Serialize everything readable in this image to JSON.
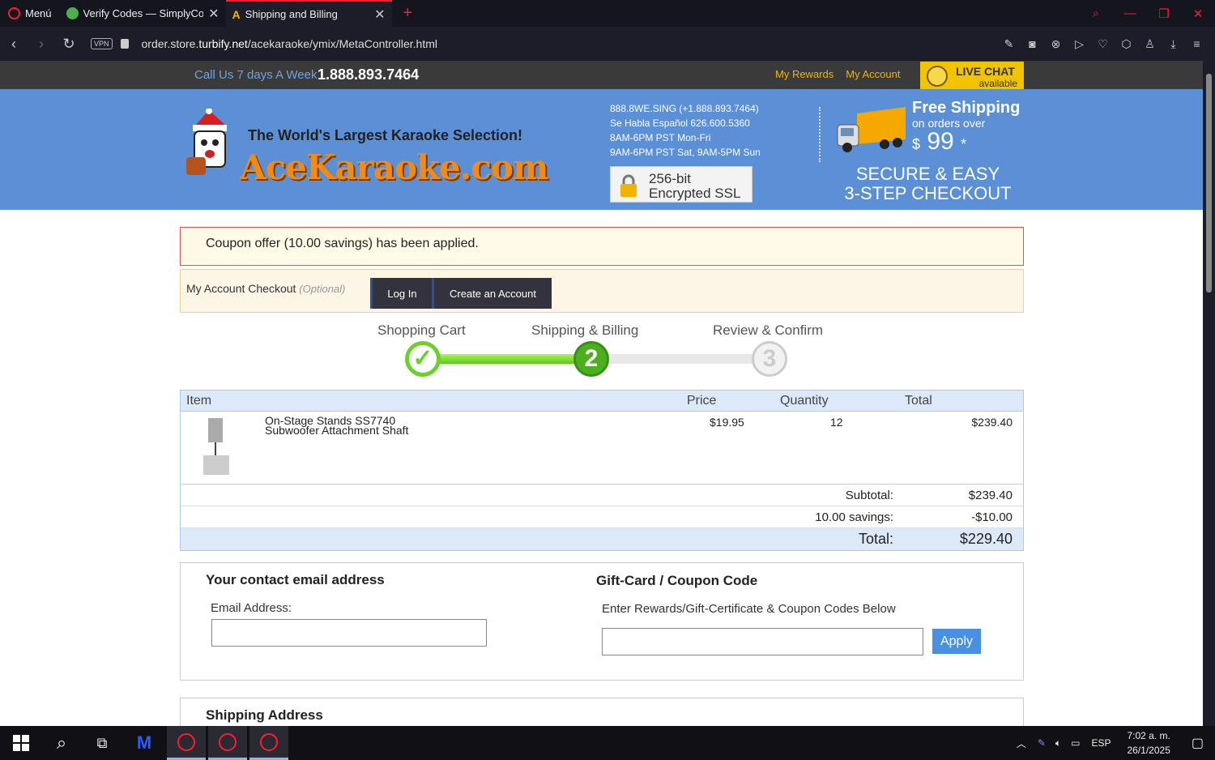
{
  "browser": {
    "menu_label": "Menú",
    "tabs": [
      {
        "title": "Verify Codes — SimplyCodes",
        "active": false
      },
      {
        "title": "Shipping and Billing",
        "active": true
      }
    ],
    "url_prefix": "order.store.",
    "url_domain": "turbify.net",
    "url_path": "/acekaraoke/ymix/MetaController.html",
    "vpn_label": "VPN"
  },
  "site": {
    "call_label": "Call Us 7 days A Week",
    "phone": "1.888.893.7464",
    "top_links": [
      "My Rewards",
      "My Account"
    ],
    "live_chat": {
      "title": "LIVE CHAT",
      "status": "available"
    },
    "tagline": "The World's Largest Karaoke Selection!",
    "logo_text": "AceKaraoke.com",
    "contact_lines": [
      "888.8WE.SING (+1.888.893.7464)",
      "Se Habla Español 626.600.5360",
      "8AM-6PM PST Mon-Fri",
      "9AM-6PM PST Sat, 9AM-5PM Sun"
    ],
    "ssl": {
      "line1": "256-bit",
      "line2": "Encrypted SSL"
    },
    "free_shipping": {
      "title": "Free Shipping",
      "sub": "on orders over",
      "currency": "$",
      "amount": "99",
      "asterisk": "*"
    },
    "secure_lines": [
      "SECURE & EASY",
      "3-STEP CHECKOUT"
    ]
  },
  "coupon_message": "Coupon offer (10.00 savings) has been applied.",
  "account": {
    "label": "My Account Checkout",
    "optional": "(Optional)",
    "login_label": "Log In",
    "create_label": "Create an Account"
  },
  "steps": [
    {
      "label": "Shopping Cart",
      "number": "✓",
      "state": "done"
    },
    {
      "label": "Shipping & Billing",
      "number": "2",
      "state": "current"
    },
    {
      "label": "Review & Confirm",
      "number": "3",
      "state": "todo"
    }
  ],
  "cart": {
    "headers": {
      "item": "Item",
      "price": "Price",
      "quantity": "Quantity",
      "total": "Total"
    },
    "rows": [
      {
        "name_line1": "On-Stage Stands SS7740",
        "name_line2": "Subwoofer Attachment Shaft",
        "price": "$19.95",
        "quantity": "12",
        "total": "$239.40"
      }
    ],
    "subtotal_label": "Subtotal:",
    "subtotal": "$239.40",
    "savings_label": "10.00 savings:",
    "savings": "-$10.00",
    "total_label": "Total:",
    "total": "$229.40"
  },
  "contact_section": {
    "title": "Your contact email address",
    "email_label": "Email Address:",
    "email_value": ""
  },
  "gift_section": {
    "title": "Gift-Card / Coupon Code",
    "instructions": "Enter Rewards/Gift-Certificate & Coupon Codes Below",
    "code_value": "",
    "apply_label": "Apply"
  },
  "shipping_section": {
    "title": "Shipping Address"
  },
  "taskbar": {
    "language": "ESP",
    "time": "7:02 a. m.",
    "date": "26/1/2025"
  },
  "colors": {
    "accent_red": "#ff1b2d",
    "banner_blue": "#5b8fd6",
    "brand_orange": "#f08a18",
    "progress_green": "#5fc81a"
  }
}
